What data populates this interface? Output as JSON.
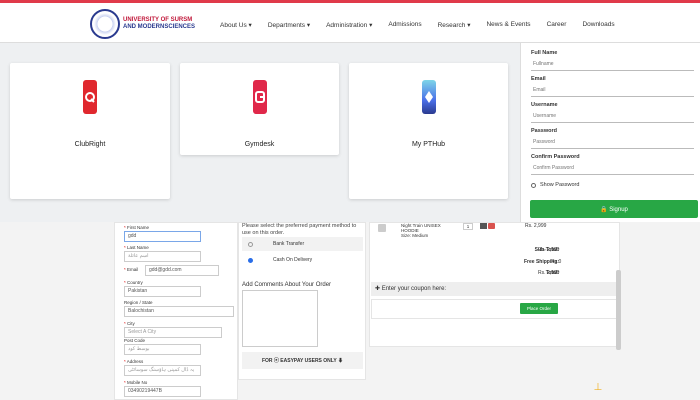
{
  "header": {
    "logo_line1": "UNIVERSITY OF SURSM",
    "logo_line2": "AND MODERNSCIENCES",
    "nav": [
      "About Us ▾",
      "Departments ▾",
      "Administration ▾",
      "Admissions",
      "Research ▾",
      "News & Events",
      "Career",
      "Downloads"
    ]
  },
  "apps": [
    {
      "label": "ClubRight",
      "color": "#e0282e",
      "glyph": "Q"
    },
    {
      "label": "Gymdesk",
      "color": "#e0284a",
      "glyph": "G"
    },
    {
      "label": "My PTHub",
      "color": "#3a8ee8",
      "glyph": "◆"
    }
  ],
  "signup": {
    "fields": [
      {
        "label": "Full Name",
        "placeholder": "Fullname"
      },
      {
        "label": "Email",
        "placeholder": "Email"
      },
      {
        "label": "Username",
        "placeholder": "Username"
      },
      {
        "label": "Password",
        "placeholder": "Password"
      },
      {
        "label": "Confirm Password",
        "placeholder": "Confirm Password"
      }
    ],
    "show_password": "Show Password",
    "button": "🔒 Signup"
  },
  "billing": {
    "first_name_label": "First Name",
    "first_name_value": "gdd",
    "last_name_label": "Last Name",
    "last_name_value": "اسم عائلة",
    "email_label": "Email",
    "email_value": "gdd@gdd.com",
    "country_label": "Country",
    "country_value": "Pakistan",
    "region_label": "Region / State",
    "region_value": "Balochistan",
    "city_label": "City",
    "city_value": "Select A City",
    "postcode_label": "Post Code",
    "postcode_value": "بوسط كود",
    "address_label": "Address",
    "address_value": "یہ ڈال کمپنی ہاؤسنگ سوسائٹی",
    "mobile_label": "Mobile No",
    "mobile_value": "03490219447B"
  },
  "payment": {
    "intro": "Please select the preferred payment method to use on this order.",
    "bank": "Bank Transfer",
    "cod": "Cash On Delivery",
    "comments_title": "Add Comments About Your Order",
    "easypay": "FOR ⓔ EASYPAY USERS ONLY ⬇"
  },
  "order": {
    "product_name": "Night Train UNISEX HOODIE",
    "product_size": "Size: Medium",
    "qty": "1",
    "price": "Rs. 2,999",
    "subtotal_label": "Sub-Total:",
    "subtotal": "Rs. 2,999",
    "shipping_label": "Free Shipping:",
    "shipping": "Rs.0",
    "total_label": "Total:",
    "total": "Rs. 2,999",
    "coupon": "✚ Enter your coupon here:",
    "place_order": "Place Order"
  }
}
